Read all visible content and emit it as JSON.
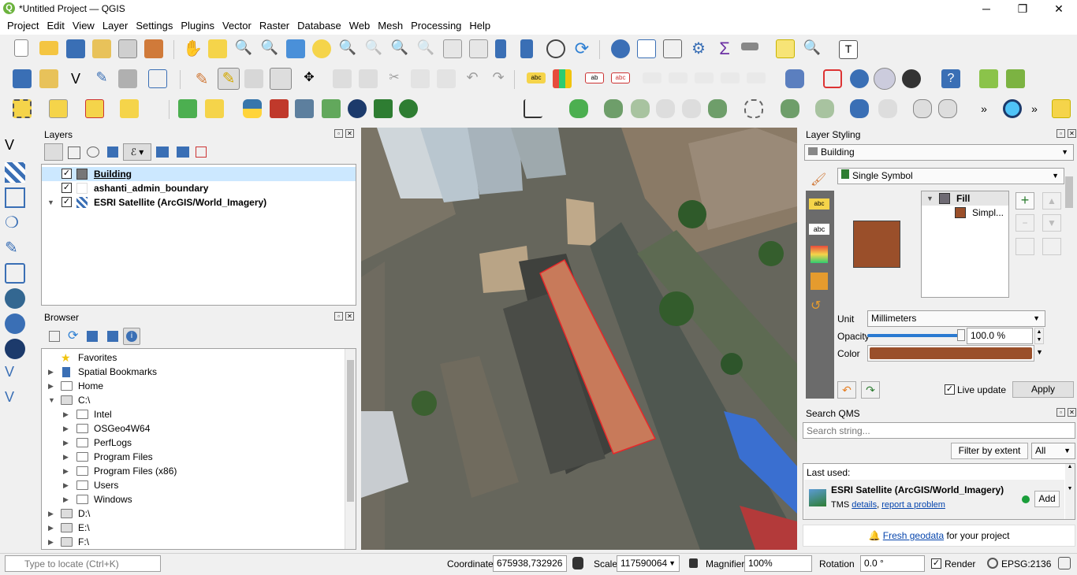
{
  "window": {
    "title": "*Untitled Project — QGIS",
    "minimize": "─",
    "restore": "❐",
    "close": "✕"
  },
  "menu": [
    "Project",
    "Edit",
    "View",
    "Layer",
    "Settings",
    "Plugins",
    "Vector",
    "Raster",
    "Database",
    "Web",
    "Mesh",
    "Processing",
    "Help"
  ],
  "layers_panel": {
    "title": "Layers",
    "items": [
      {
        "name": "Building",
        "checked": true,
        "selected": true
      },
      {
        "name": "ashanti_admin_boundary",
        "checked": true
      },
      {
        "name": "ESRI Satellite (ArcGIS/World_Imagery)",
        "checked": true
      }
    ]
  },
  "browser_panel": {
    "title": "Browser",
    "items": [
      "Favorites",
      "Spatial Bookmarks",
      "Home",
      "C:\\",
      "Intel",
      "OSGeo4W64",
      "PerfLogs",
      "Program Files",
      "Program Files (x86)",
      "Users",
      "Windows",
      "D:\\",
      "E:\\",
      "F:\\"
    ]
  },
  "styling": {
    "title": "Layer Styling",
    "layer": "Building",
    "renderer": "Single Symbol",
    "fill": "Fill",
    "simple": "Simpl...",
    "fill_color": "#9a4f2a",
    "unit_label": "Unit",
    "unit_value": "Millimeters",
    "opacity_label": "Opacity",
    "opacity_value": "100.0 %",
    "color_label": "Color",
    "live_update": "Live update",
    "apply": "Apply"
  },
  "qms": {
    "title": "Search QMS",
    "placeholder": "Search string...",
    "filter_button": "Filter by extent",
    "filter_value": "All",
    "last_used": "Last used:",
    "result_name": "ESRI Satellite (ArcGIS/World_Imagery)",
    "result_type": "TMS",
    "details": "details",
    "report": "report a problem",
    "add": "Add",
    "fresh_link": "Fresh geodata",
    "fresh_suffix": "for your project"
  },
  "status": {
    "locate_placeholder": "Type to locate (Ctrl+K)",
    "coordinate_label": "Coordinate",
    "coordinate": "675938,732926",
    "scale_label": "Scale",
    "scale": "117590064",
    "magnifier_label": "Magnifier",
    "magnifier": "100%",
    "rotation_label": "Rotation",
    "rotation": "0.0 °",
    "render_label": "Render",
    "crs": "EPSG:2136"
  },
  "colors": {
    "accent": "#3c8a2e",
    "selection": "#cce8ff",
    "building_outline": "#e8272a"
  }
}
